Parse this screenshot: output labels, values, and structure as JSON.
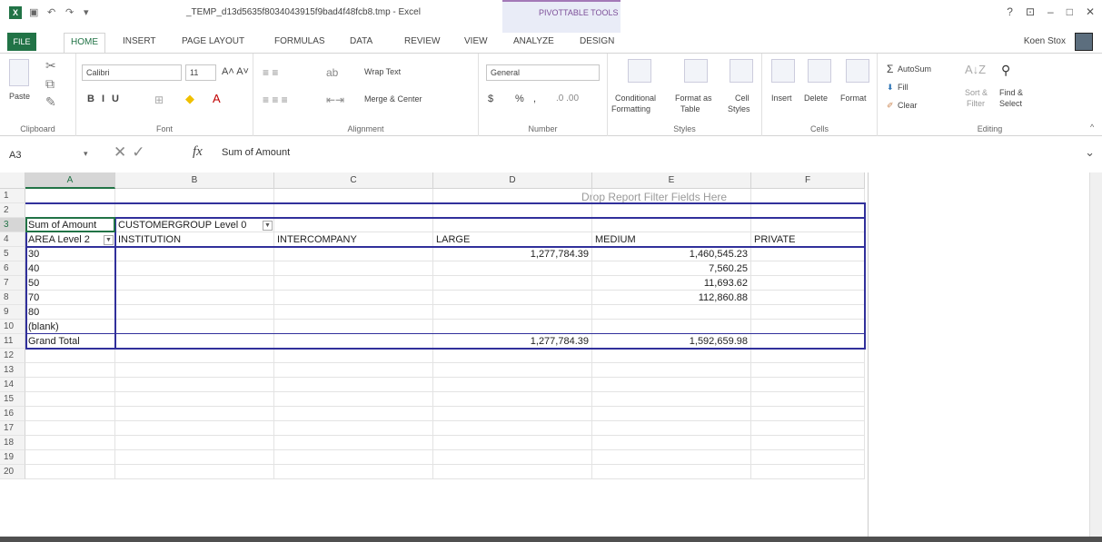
{
  "window": {
    "title": "_TEMP_d13d5635f8034043915f9bad4f48fcb8.tmp - Excel",
    "contextual_tab_group": "PIVOTTABLE TOOLS",
    "help": "?",
    "user": "Koen Stox"
  },
  "tabs": [
    "FILE",
    "HOME",
    "INSERT",
    "PAGE LAYOUT",
    "FORMULAS",
    "DATA",
    "REVIEW",
    "VIEW",
    "ANALYZE",
    "DESIGN"
  ],
  "ribbon": {
    "clipboard": {
      "paste": "Paste",
      "label": "Clipboard"
    },
    "font": {
      "name": "Calibri",
      "size": "11",
      "label": "Font"
    },
    "alignment": {
      "wrap": "Wrap Text",
      "merge": "Merge & Center",
      "label": "Alignment"
    },
    "number": {
      "format": "General",
      "currency": "$",
      "percent": "%",
      "comma": ",",
      "label": "Number"
    },
    "styles": {
      "conditional1": "Conditional",
      "conditional2": "Formatting",
      "format_as1": "Format as",
      "format_as2": "Table",
      "cell1": "Cell",
      "cell2": "Styles",
      "label": "Styles"
    },
    "cells": {
      "insert": "Insert",
      "delete": "Delete",
      "format": "Format",
      "label": "Cells"
    },
    "editing": {
      "autosum": "AutoSum",
      "fill": "Fill",
      "clear": "Clear",
      "sort1": "Sort &",
      "sort2": "Filter",
      "find1": "Find &",
      "find2": "Select",
      "label": "Editing"
    }
  },
  "formula_bar": {
    "name_box": "A3",
    "fx": "fx",
    "formula": "Sum of Amount"
  },
  "sheet": {
    "columns": [
      "A",
      "B",
      "C",
      "D",
      "E",
      "F"
    ],
    "rows": [
      "1",
      "2",
      "3",
      "4",
      "5",
      "6",
      "7",
      "8",
      "9",
      "10",
      "11",
      "12",
      "13",
      "14",
      "15",
      "16",
      "17",
      "18",
      "19",
      "20"
    ],
    "drop_report_filter": "Drop Report Filter Fields Here",
    "pivot": {
      "value_label": "Sum of Amount",
      "column_field": "CUSTOMERGROUP Level 0",
      "row_field": "AREA Level 2",
      "column_headers": [
        "INSTITUTION",
        "INTERCOMPANY",
        "LARGE",
        "MEDIUM",
        "PRIVATE"
      ],
      "rows": [
        {
          "label": "30",
          "large": "1,277,784.39",
          "medium": "1,460,545.23"
        },
        {
          "label": "40",
          "large": "",
          "medium": "7,560.25"
        },
        {
          "label": "50",
          "large": "",
          "medium": "11,693.62"
        },
        {
          "label": "70",
          "large": "",
          "medium": "112,860.88"
        },
        {
          "label": "80",
          "large": "",
          "medium": ""
        },
        {
          "label": "(blank)",
          "large": "",
          "medium": ""
        },
        {
          "label": "Grand Total",
          "large": "1,277,784.39",
          "medium": "1,592,659.98"
        }
      ]
    }
  }
}
